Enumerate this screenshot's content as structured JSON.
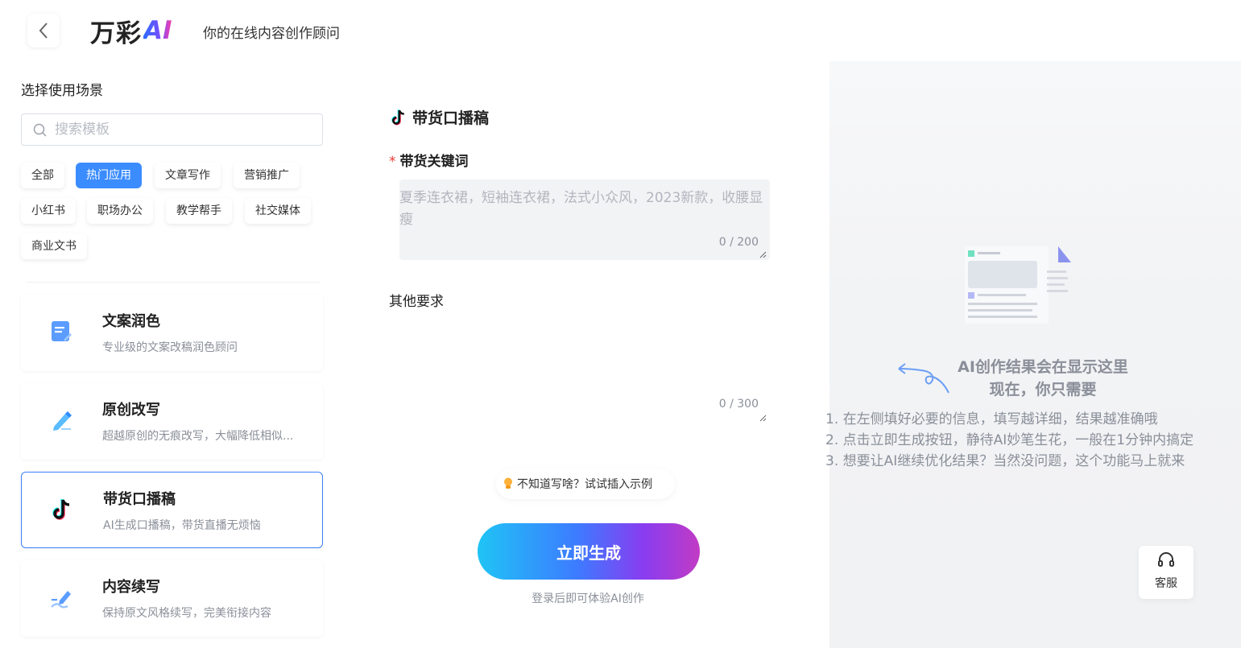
{
  "header": {
    "back_label": "<",
    "logo_text": "万彩",
    "logo_ai": "AI",
    "tagline": "你的在线内容创作顾问"
  },
  "sidebar": {
    "title": "选择使用场景",
    "search_placeholder": "搜索模板",
    "tags": [
      "全部",
      "热门应用",
      "文章写作",
      "营销推广",
      "小红书",
      "职场办公",
      "教学帮手",
      "社交媒体",
      "商业文书"
    ],
    "active_tag": "热门应用",
    "cards": [
      {
        "title": "文案润色",
        "desc": "专业级的文案改稿润色顾问",
        "icon": "document-edit-icon"
      },
      {
        "title": "原创改写",
        "desc": "超越原创的无痕改写，大幅降低相似...",
        "icon": "pencil-icon"
      },
      {
        "title": "带货口播稿",
        "desc": "AI生成口播稿，带货直播无烦恼",
        "icon": "tiktok-icon"
      },
      {
        "title": "内容续写",
        "desc": "保持原文风格续写，完美衔接内容",
        "icon": "pen-write-icon"
      }
    ]
  },
  "form": {
    "title": "带货口播稿",
    "keyword_label": "带货关键词",
    "keyword_required_mark": "*",
    "keyword_placeholder": "夏季连衣裙，短袖连衣裙，法式小众风，2023新款，收腰显瘦",
    "keyword_counter": "0 / 200",
    "other_label": "其他要求",
    "other_counter": "0 / 300",
    "example_hint": "不知道写啥？试试插入示例",
    "generate_label": "立即生成",
    "login_hint": "登录后即可体验AI创作"
  },
  "result": {
    "heading_line1": "AI创作结果会在显示这里",
    "heading_line2": "现在，你只需要",
    "steps": [
      "1. 在左侧填好必要的信息，填写越详细，结果越准确哦",
      "2. 点击立即生成按钮，静待AI妙笔生花，一般在1分钟内搞定",
      "3. 想要让AI继续优化结果？当然没问题，这个功能马上就来"
    ],
    "service_label": "客服"
  },
  "colors": {
    "accent": "#3b8cff",
    "active_border": "#3b82f6",
    "required": "#e53935",
    "button_gradient_start": "#1fc4f5",
    "button_gradient_end": "#c13bc4"
  }
}
